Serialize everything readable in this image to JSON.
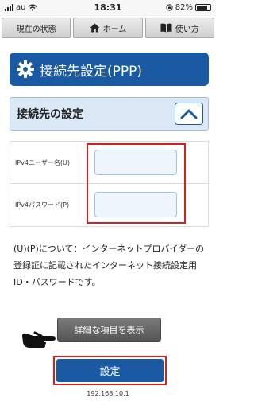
{
  "status_bar": {
    "carrier": "au",
    "time": "18:31",
    "battery": "82%",
    "battery_level": 0.82
  },
  "nav": {
    "items": [
      {
        "label": "現在の状態"
      },
      {
        "label": "ホーム",
        "icon": "home-icon"
      },
      {
        "label": "使い方",
        "icon": "book-icon"
      }
    ]
  },
  "title": "接続先設定(PPP)",
  "section": {
    "label": "接続先の設定"
  },
  "form": {
    "fields": [
      {
        "label": "IPv4ユーザー名(U)",
        "value": ""
      },
      {
        "label": "IPv4パスワード(P)",
        "value": ""
      }
    ]
  },
  "note": "(U)(P)について：インターネットプロバイダーの登録証に記載されたインターネット接続設定用ID・パスワードです。",
  "buttons": {
    "details": "詳細な項目を表示",
    "submit": "設定"
  },
  "footer": {
    "ip": "192.168.10.1"
  },
  "colors": {
    "primary": "#1a5aa3",
    "highlight": "#d42020",
    "section_bg": "#dbe9f7"
  }
}
